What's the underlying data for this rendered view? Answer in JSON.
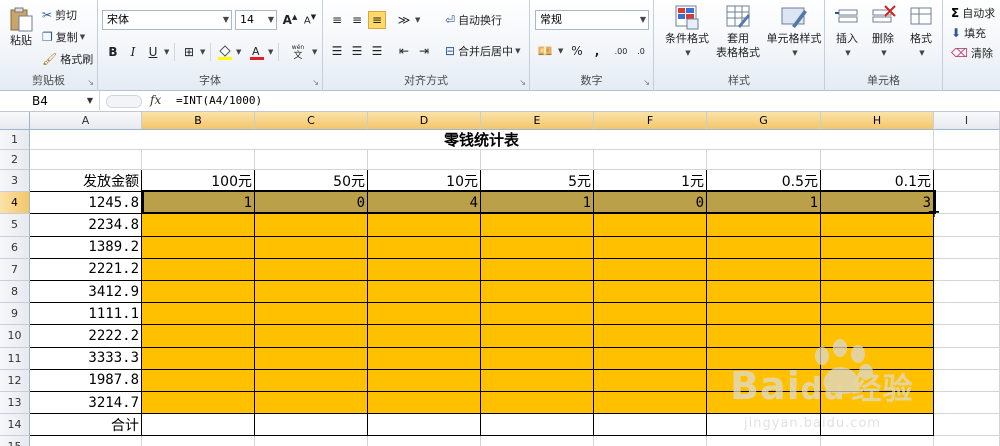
{
  "ribbon": {
    "clipboard": {
      "paste": "粘贴",
      "cut": "剪切",
      "copy": "复制",
      "format_painter": "格式刷",
      "label": "剪贴板"
    },
    "font": {
      "name": "宋体",
      "size": "14",
      "bold": "B",
      "italic": "I",
      "underline": "U",
      "label": "字体",
      "wen": "wén"
    },
    "alignment": {
      "wrap": "自动换行",
      "merge": "合并后居中",
      "label": "对齐方式"
    },
    "number": {
      "format": "常规",
      "percent": "%",
      "comma": ",",
      "label": "数字"
    },
    "styles": {
      "conditional": "条件格式",
      "table_format_line1": "套用",
      "table_format_line2": "表格格式",
      "cell_styles": "单元格样式",
      "label": "样式"
    },
    "cells": {
      "insert": "插入",
      "delete": "删除",
      "format": "格式",
      "label": "单元格"
    },
    "editing": {
      "autosum": "自动求",
      "fill": "填充",
      "clear": "清除",
      "sigma": "Σ"
    }
  },
  "formula_bar": {
    "name_box": "B4",
    "fx": "fx",
    "formula": "=INT(A4/1000)"
  },
  "sheet": {
    "columns": [
      "A",
      "B",
      "C",
      "D",
      "E",
      "F",
      "G",
      "H",
      "I"
    ],
    "rows": [
      "1",
      "2",
      "3",
      "4",
      "5",
      "6",
      "7",
      "8",
      "9",
      "10",
      "11",
      "12",
      "13",
      "14",
      "15"
    ],
    "title": "零钱统计表",
    "header_a": "发放金额",
    "denominations": [
      "100元",
      "50元",
      "10元",
      "5元",
      "1元",
      "0.5元",
      "0.1元"
    ],
    "amounts": [
      "1245.8",
      "2234.8",
      "1389.2",
      "2221.2",
      "3412.9",
      "1111.1",
      "2222.2",
      "3333.3",
      "1987.8",
      "3214.7"
    ],
    "row4_values": [
      "1",
      "0",
      "4",
      "1",
      "0",
      "1",
      "3"
    ],
    "total_label": "合计"
  },
  "watermark": {
    "brand": "Bai",
    "brand2": "du",
    "jingyan": "经验",
    "url": "jingyan.baidu.com"
  }
}
